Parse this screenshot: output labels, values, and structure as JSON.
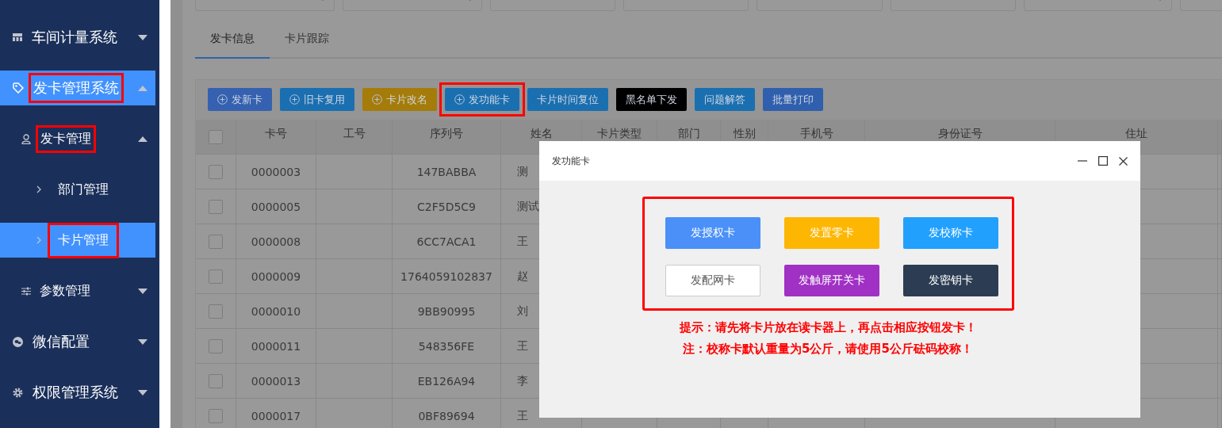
{
  "sidebar": {
    "items": [
      {
        "label": "车间计量系统",
        "expanded": false,
        "selected": false,
        "annotated": false
      },
      {
        "label": "发卡管理系统",
        "expanded": true,
        "selected": true,
        "annotated": true,
        "children": [
          {
            "label": "发卡管理",
            "expanded": true,
            "selected": false,
            "annotated": true,
            "children": [
              {
                "label": "部门管理",
                "selected": false,
                "annotated": false
              },
              {
                "label": "卡片管理",
                "selected": true,
                "annotated": true
              }
            ]
          },
          {
            "label": "参数管理",
            "expanded": false,
            "selected": false,
            "annotated": false
          }
        ]
      },
      {
        "label": "微信配置",
        "expanded": false,
        "selected": false,
        "annotated": false
      },
      {
        "label": "权限管理系统",
        "expanded": false,
        "selected": false,
        "annotated": false
      }
    ]
  },
  "tabs": [
    {
      "label": "发卡信息",
      "selected": true
    },
    {
      "label": "卡片跟踪",
      "selected": false
    }
  ],
  "toolbar": [
    {
      "label": "发新卡",
      "color": "#3561b0",
      "plus": true,
      "annotated": false
    },
    {
      "label": "旧卡复用",
      "color": "#1a6fb0",
      "plus": true,
      "annotated": false
    },
    {
      "label": "卡片改名",
      "color": "#a57c0a",
      "plus": true,
      "annotated": false
    },
    {
      "label": "发功能卡",
      "color": "#1a6fb0",
      "plus": true,
      "annotated": true
    },
    {
      "label": "卡片时间复位",
      "color": "#1a6fb0",
      "plus": false,
      "annotated": false
    },
    {
      "label": "黑名单下发",
      "color": "#000000",
      "plus": false,
      "annotated": false
    },
    {
      "label": "问题解答",
      "color": "#1a6fb0",
      "plus": false,
      "annotated": false
    },
    {
      "label": "批量打印",
      "color": "#2f5fad",
      "plus": false,
      "annotated": false
    }
  ],
  "table": {
    "all_selected": false,
    "columns": [
      "卡号",
      "工号",
      "序列号",
      "姓名",
      "卡片类型",
      "部门",
      "性别",
      "手机号",
      "身份证号",
      "住址"
    ],
    "rows": [
      {
        "selected": false,
        "cells": [
          "0000003",
          "",
          "147BABBA",
          "测"
        ]
      },
      {
        "selected": false,
        "cells": [
          "0000005",
          "",
          "C2F5D5C9",
          "测试"
        ]
      },
      {
        "selected": false,
        "cells": [
          "0000008",
          "",
          "6CC7ACA1",
          "王"
        ]
      },
      {
        "selected": false,
        "cells": [
          "0000009",
          "",
          "1764059102837",
          "赵"
        ]
      },
      {
        "selected": false,
        "cells": [
          "0000010",
          "",
          "9BB90995",
          "刘"
        ]
      },
      {
        "selected": false,
        "cells": [
          "0000011",
          "",
          "548356FE",
          "王"
        ]
      },
      {
        "selected": false,
        "cells": [
          "0000013",
          "",
          "EB126A94",
          "李"
        ]
      },
      {
        "selected": false,
        "cells": [
          "0000017",
          "",
          "0BF89694",
          "王"
        ]
      }
    ]
  },
  "dialog": {
    "title": "发功能卡",
    "annotated": true,
    "buttons": [
      {
        "label": "发授权卡",
        "kind": "filled",
        "color": "#4a90f8"
      },
      {
        "label": "发置零卡",
        "kind": "filled",
        "color": "#fdb602"
      },
      {
        "label": "发校称卡",
        "kind": "filled",
        "color": "#22a0fd"
      },
      {
        "label": "发配网卡",
        "kind": "plain",
        "color": "#ffffff"
      },
      {
        "label": "发触屏开关卡",
        "kind": "filled",
        "color": "#a031c4"
      },
      {
        "label": "发密钥卡",
        "kind": "filled",
        "color": "#2c3c52"
      }
    ],
    "notes": [
      "提示：请先将卡片放在读卡器上，再点击相应按钮发卡！",
      "注：校称卡默认重量为5公斤，请使用5公斤砝码校称！"
    ]
  }
}
